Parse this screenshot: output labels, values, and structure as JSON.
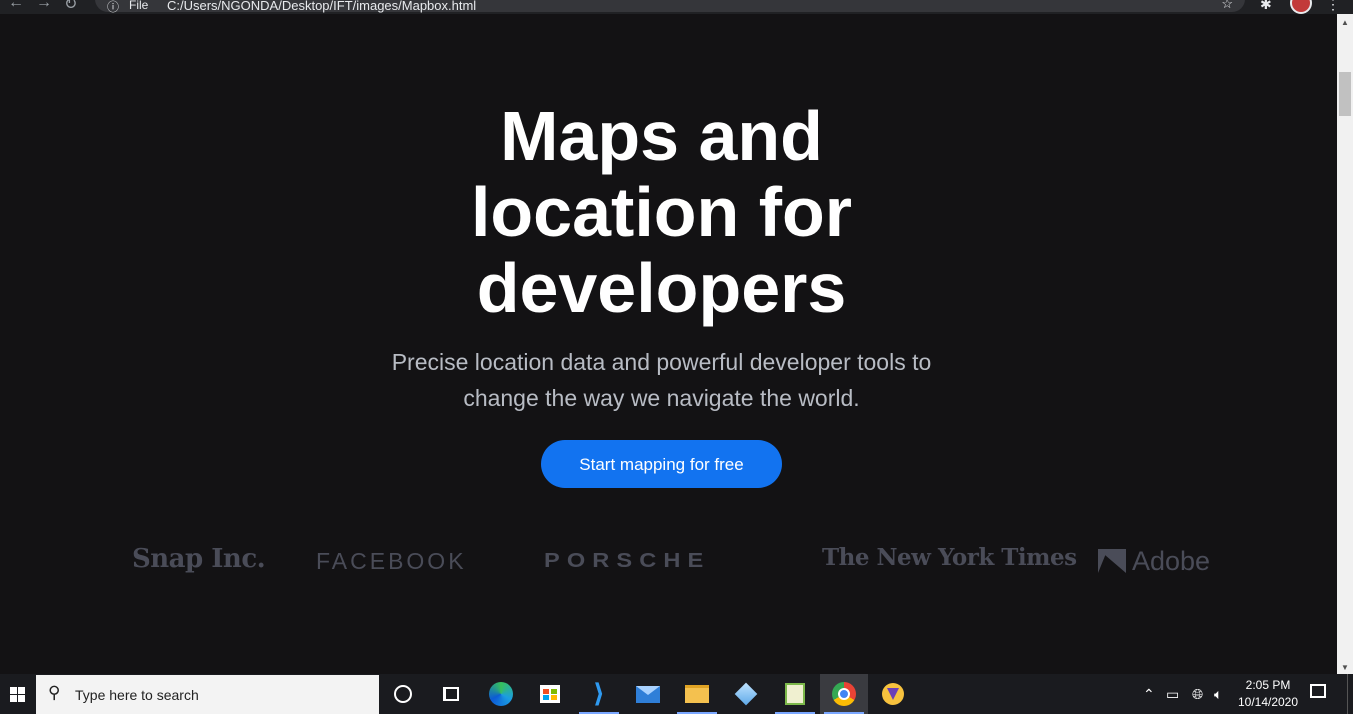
{
  "browser": {
    "url_scheme": "File",
    "url": "C:/Users/NGONDA/Desktop/IFT/images/Mapbox.html"
  },
  "hero": {
    "title_lines": [
      "Maps and",
      "location for",
      "developers"
    ],
    "subtitle_lines": [
      "Precise location data and powerful developer tools to",
      "change the way we navigate the world."
    ],
    "cta_label": "Start mapping for free"
  },
  "logos": {
    "snap": "Snap Inc.",
    "facebook": "FACEBOOK",
    "porsche": "PORSCHE",
    "nyt": "The New York Times",
    "adobe": "Adobe"
  },
  "taskbar": {
    "search_placeholder": "Type here to search",
    "time": "2:05 PM",
    "date": "10/14/2020"
  },
  "colors": {
    "page_bg": "#131214",
    "cta_bg": "#1273f0",
    "logo_gray": "#4a4c58"
  }
}
